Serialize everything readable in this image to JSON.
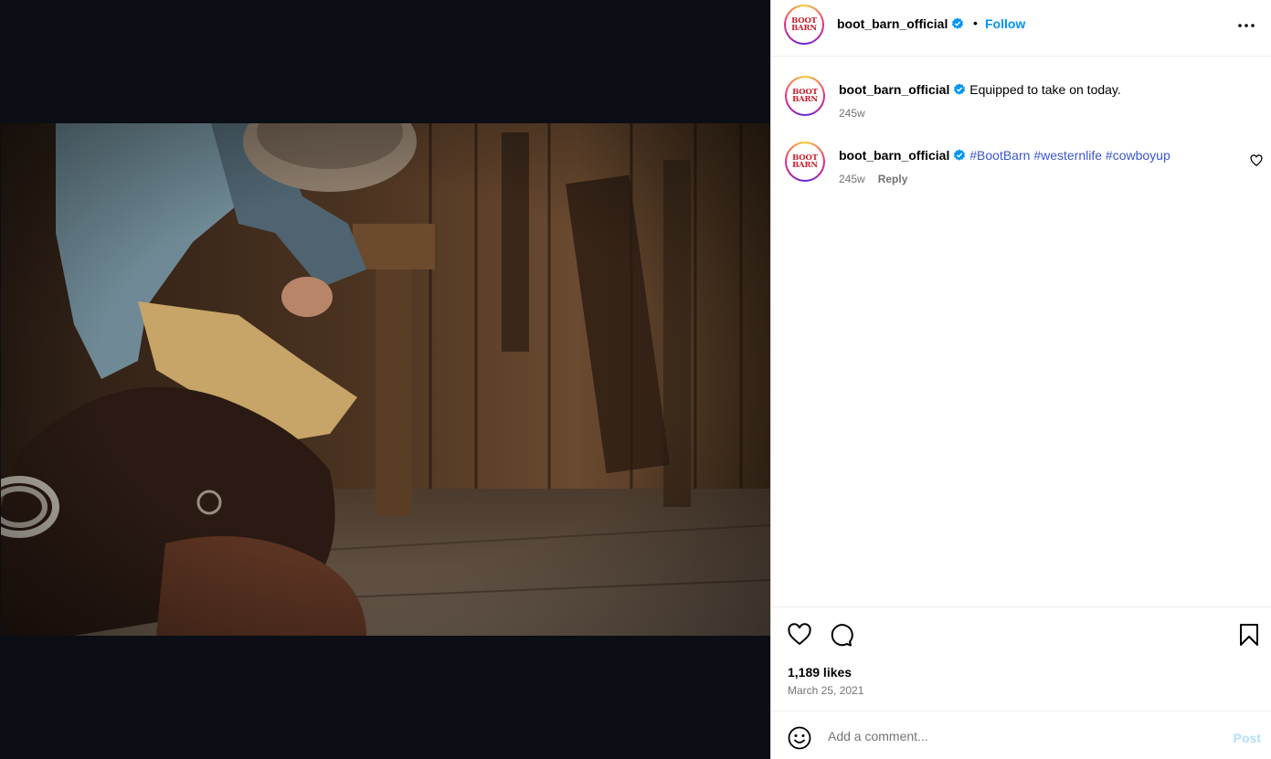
{
  "colors": {
    "media_background": "#0b0e14",
    "follow_blue": "#0095f6",
    "hashtag_blue": "#3a56cf",
    "verified_blue": "#0095f6",
    "muted_gray": "#737373",
    "post_disabled": "#b2dffc",
    "brand_red": "#c8202f"
  },
  "post": {
    "image_icon": "photo-cowboy-saddle",
    "avatar_logo_lines": [
      "BOOT",
      "BARN"
    ]
  },
  "header": {
    "username": "boot_barn_official",
    "dot": "•",
    "follow_label": "Follow",
    "more_icon": "more-horizontal-icon"
  },
  "comments": [
    {
      "username": "boot_barn_official",
      "text": "Equipped to take on today.",
      "time": "245w"
    },
    {
      "username": "boot_barn_official",
      "hashtags": [
        "#BootBarn",
        "#westernlife",
        "#cowboyup"
      ],
      "time": "245w",
      "reply_label": "Reply"
    }
  ],
  "actions": {
    "like_icon": "heart-icon",
    "comment_icon": "comment-bubble-icon",
    "save_icon": "bookmark-icon",
    "likes": "1,189 likes",
    "date": "March 25, 2021"
  },
  "composer": {
    "emoji_icon": "emoji-icon",
    "placeholder": "Add a comment...",
    "post_label": "Post"
  }
}
